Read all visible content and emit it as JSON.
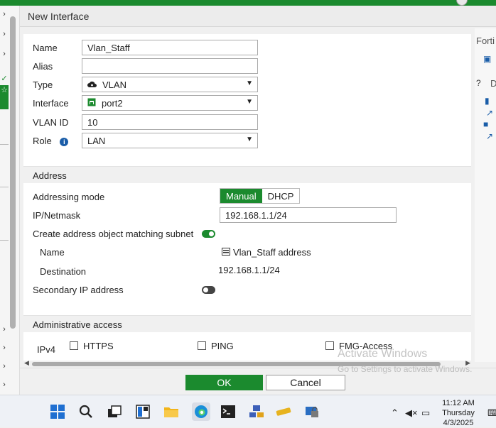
{
  "header": {
    "title": "New Interface"
  },
  "form": {
    "name_label": "Name",
    "name_value": "Vlan_Staff",
    "alias_label": "Alias",
    "alias_value": "",
    "type_label": "Type",
    "type_value": "VLAN",
    "interface_label": "Interface",
    "interface_value": "port2",
    "vlanid_label": "VLAN ID",
    "vlanid_value": "10",
    "role_label": "Role",
    "role_value": "LAN"
  },
  "address": {
    "section_title": "Address",
    "mode_label": "Addressing mode",
    "mode_options": [
      "Manual",
      "DHCP"
    ],
    "mode_selected": "Manual",
    "ipmask_label": "IP/Netmask",
    "ipmask_value": "192.168.1.1/24",
    "create_obj_label": "Create address object matching subnet",
    "create_obj_enabled": true,
    "obj_name_label": "Name",
    "obj_name_value": "Vlan_Staff address",
    "obj_dest_label": "Destination",
    "obj_dest_value": "192.168.1.1/24",
    "secondary_label": "Secondary IP address",
    "secondary_enabled": false
  },
  "admin": {
    "section_title": "Administrative access",
    "ipv4_label": "IPv4",
    "options": [
      "HTTPS",
      "PING",
      "FMG-Access"
    ]
  },
  "right_panel": {
    "label": "Forti",
    "d_label": "D"
  },
  "buttons": {
    "ok": "OK",
    "cancel": "Cancel"
  },
  "watermark": {
    "line1": "Activate Windows",
    "line2": "Go to Settings to activate Windows."
  },
  "clock": {
    "time": "11:12 AM",
    "day": "Thursday",
    "date": "4/3/2025"
  },
  "colors": {
    "accent": "#1b8a2e",
    "toggle_on": "#1b8a2e",
    "toggle_off": "#444444"
  }
}
